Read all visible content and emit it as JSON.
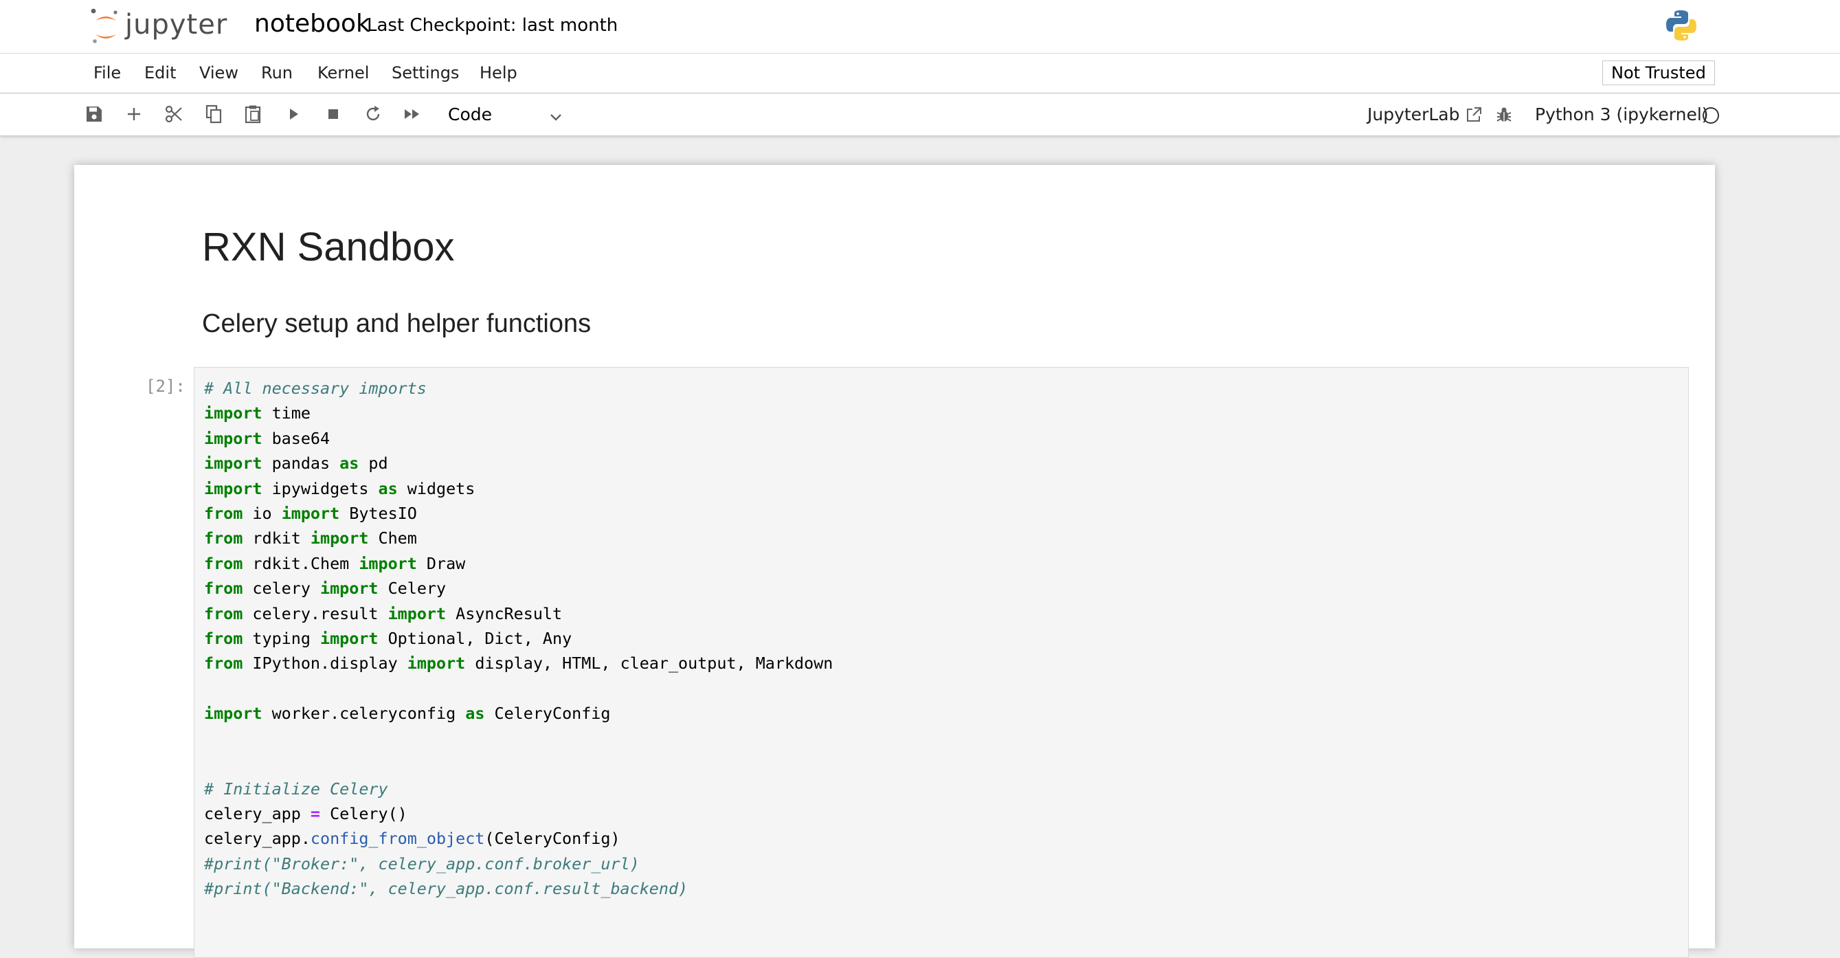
{
  "header": {
    "logo_text": "jupyter",
    "notebook_name": "notebook",
    "checkpoint": "Last Checkpoint: last month"
  },
  "menu": {
    "items": [
      "File",
      "Edit",
      "View",
      "Run",
      "Kernel",
      "Settings",
      "Help"
    ],
    "trust_status": "Not Trusted"
  },
  "toolbar": {
    "cell_type": "Code",
    "jupyterlab_label": "JupyterLab",
    "kernel_name": "Python 3 (ipykernel)"
  },
  "notebook": {
    "title": "RXN Sandbox",
    "subtitle": "Celery setup and helper functions",
    "cell_prompt": "[2]:",
    "code_lines": [
      [
        {
          "t": "cm",
          "v": "# All necessary imports"
        }
      ],
      [
        {
          "t": "kw",
          "v": "import"
        },
        {
          "t": "",
          "v": " time"
        }
      ],
      [
        {
          "t": "kw",
          "v": "import"
        },
        {
          "t": "",
          "v": " base64"
        }
      ],
      [
        {
          "t": "kw",
          "v": "import"
        },
        {
          "t": "",
          "v": " pandas "
        },
        {
          "t": "kw",
          "v": "as"
        },
        {
          "t": "",
          "v": " pd"
        }
      ],
      [
        {
          "t": "kw",
          "v": "import"
        },
        {
          "t": "",
          "v": " ipywidgets "
        },
        {
          "t": "kw",
          "v": "as"
        },
        {
          "t": "",
          "v": " widgets"
        }
      ],
      [
        {
          "t": "kw",
          "v": "from"
        },
        {
          "t": "",
          "v": " io "
        },
        {
          "t": "kw",
          "v": "import"
        },
        {
          "t": "",
          "v": " BytesIO"
        }
      ],
      [
        {
          "t": "kw",
          "v": "from"
        },
        {
          "t": "",
          "v": " rdkit "
        },
        {
          "t": "kw",
          "v": "import"
        },
        {
          "t": "",
          "v": " Chem"
        }
      ],
      [
        {
          "t": "kw",
          "v": "from"
        },
        {
          "t": "",
          "v": " rdkit.Chem "
        },
        {
          "t": "kw",
          "v": "import"
        },
        {
          "t": "",
          "v": " Draw"
        }
      ],
      [
        {
          "t": "kw",
          "v": "from"
        },
        {
          "t": "",
          "v": " celery "
        },
        {
          "t": "kw",
          "v": "import"
        },
        {
          "t": "",
          "v": " Celery"
        }
      ],
      [
        {
          "t": "kw",
          "v": "from"
        },
        {
          "t": "",
          "v": " celery.result "
        },
        {
          "t": "kw",
          "v": "import"
        },
        {
          "t": "",
          "v": " AsyncResult"
        }
      ],
      [
        {
          "t": "kw",
          "v": "from"
        },
        {
          "t": "",
          "v": " typing "
        },
        {
          "t": "kw",
          "v": "import"
        },
        {
          "t": "",
          "v": " Optional, Dict, Any"
        }
      ],
      [
        {
          "t": "kw",
          "v": "from"
        },
        {
          "t": "",
          "v": " IPython.display "
        },
        {
          "t": "kw",
          "v": "import"
        },
        {
          "t": "",
          "v": " display, HTML, clear_output, Markdown"
        }
      ],
      [],
      [
        {
          "t": "kw",
          "v": "import"
        },
        {
          "t": "",
          "v": " worker.celeryconfig "
        },
        {
          "t": "kw",
          "v": "as"
        },
        {
          "t": "",
          "v": " CeleryConfig"
        }
      ],
      [],
      [],
      [
        {
          "t": "cm",
          "v": "# Initialize Celery"
        }
      ],
      [
        {
          "t": "",
          "v": "celery_app "
        },
        {
          "t": "op",
          "v": "="
        },
        {
          "t": "",
          "v": " Celery()"
        }
      ],
      [
        {
          "t": "",
          "v": "celery_app."
        },
        {
          "t": "at",
          "v": "config_from_object"
        },
        {
          "t": "",
          "v": "(CeleryConfig)"
        }
      ],
      [
        {
          "t": "cm",
          "v": "#print(\"Broker:\", celery_app.conf.broker_url)"
        }
      ],
      [
        {
          "t": "cm",
          "v": "#print(\"Backend:\", celery_app.conf.result_backend)"
        }
      ]
    ]
  },
  "colors": {
    "keyword": "#008000",
    "comment": "#3d7b7b",
    "operator": "#aa22ff",
    "attribute": "#2a5db0",
    "logo_orange": "#f37726"
  }
}
